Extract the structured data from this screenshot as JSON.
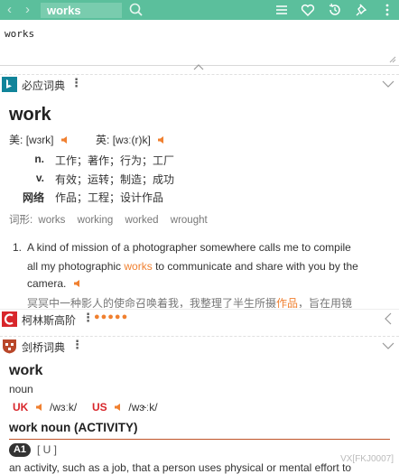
{
  "topbar": {
    "search_text": "works",
    "back": "‹",
    "forward": "›"
  },
  "query": {
    "text": "works"
  },
  "bing": {
    "title": "必应词典",
    "word": "work",
    "us_label": "美:",
    "us_phon": "[wɜrk]",
    "uk_label": "英:",
    "uk_phon": "[wɜː(r)k]",
    "senses": [
      {
        "pos": "n.",
        "def": "工作；著作；行为；工厂"
      },
      {
        "pos": "v.",
        "def": "有效；运转；制造；成功"
      },
      {
        "pos": "网络",
        "def": "作品；工程；设计作品"
      }
    ],
    "forms_label": "词形:",
    "forms": [
      "works",
      "working",
      "worked",
      "wrought"
    ],
    "example_num": "1.",
    "example_line1": "A kind of mission of a photographer somewhere calls me to compile",
    "example_line2_a": "all my photographic ",
    "example_line2_hl": "works",
    "example_line2_b": " to communicate and share with you by the",
    "example_line3": "camera.",
    "example_cn_a": "冥冥中一种影人的使命召唤着我，我整理了半生所摄",
    "example_cn_hl": "作品",
    "example_cn_b": "，旨在用镜"
  },
  "collins": {
    "title": "柯林斯高阶",
    "stars": "●●●●●"
  },
  "cambridge": {
    "title": "剑桥词典",
    "word": "work",
    "pos": "noun",
    "uk_label": "UK",
    "uk_phon": "/wɜːk/",
    "us_label": "US",
    "us_phon": "/wɝːk/",
    "entry_head": "work noun (ACTIVITY)",
    "level": "A1",
    "grammar": "[ U ]",
    "def_line": "an activity, such as a job, that a person uses physical or mental effort to"
  },
  "watermark": "VX[FKJ0007]",
  "colors": {
    "topbar": "#5bbf9c",
    "accent": "#f08030",
    "collins_red": "#d8262b",
    "cambridge_rule": "#c0542a"
  }
}
